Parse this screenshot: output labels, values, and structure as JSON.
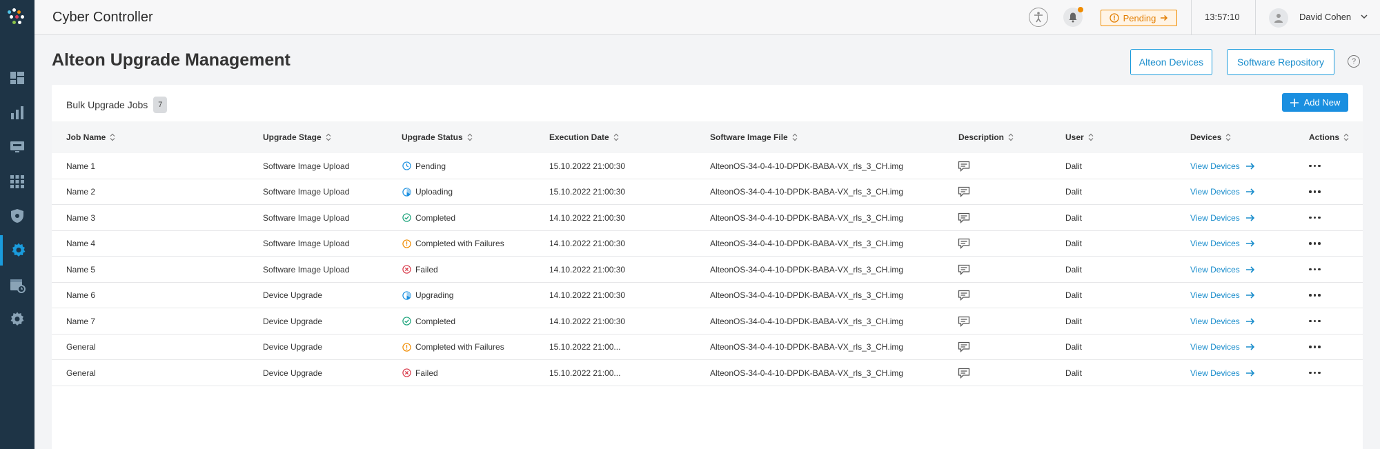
{
  "app": {
    "title": "Cyber Controller"
  },
  "topbar": {
    "pending_label": "Pending",
    "time": "13:57:10",
    "user_name": "David Cohen"
  },
  "sidebar": {
    "items": [
      {
        "icon": "dashboard-icon"
      },
      {
        "icon": "analytics-icon"
      },
      {
        "icon": "monitor-icon"
      },
      {
        "icon": "apps-grid-icon"
      },
      {
        "icon": "shield-icon"
      },
      {
        "icon": "gear-icon",
        "active": true
      },
      {
        "icon": "scheduler-icon"
      },
      {
        "icon": "settings-icon"
      }
    ]
  },
  "page": {
    "title": "Alteon Upgrade Management",
    "alteon_devices_label": "Alteon Devices",
    "software_repository_label": "Software Repository",
    "help_label": "?"
  },
  "card": {
    "title": "Bulk Upgrade Jobs",
    "count": "7",
    "add_label": "Add New"
  },
  "table": {
    "headers": {
      "job_name": "Job Name",
      "upgrade_stage": "Upgrade Stage",
      "upgrade_status": "Upgrade Status",
      "execution_date": "Execution Date",
      "software_image": "Software Image File",
      "description": "Description",
      "user": "User",
      "devices": "Devices",
      "actions": "Actions"
    },
    "rows": [
      {
        "name": "Name 1",
        "stage": "Software Image Upload",
        "status": "Pending",
        "status_type": "pending",
        "date": "15.10.2022 21:00:30",
        "image": "AlteonOS-34-0-4-10-DPDK-BABA-VX_rls_3_CH.img",
        "user": "Dalit",
        "devices": "View Devices"
      },
      {
        "name": "Name 2",
        "stage": "Software Image Upload",
        "status": "Uploading",
        "status_type": "progress",
        "date": "15.10.2022 21:00:30",
        "image": "AlteonOS-34-0-4-10-DPDK-BABA-VX_rls_3_CH.img",
        "user": "Dalit",
        "devices": "View Devices"
      },
      {
        "name": "Name 3",
        "stage": "Software Image Upload",
        "status": "Completed",
        "status_type": "completed",
        "date": "14.10.2022 21:00:30",
        "image": "AlteonOS-34-0-4-10-DPDK-BABA-VX_rls_3_CH.img",
        "user": "Dalit",
        "devices": "View Devices"
      },
      {
        "name": "Name 4",
        "stage": "Software Image Upload",
        "status": "Completed with Failures",
        "status_type": "warning",
        "date": "14.10.2022 21:00:30",
        "image": "AlteonOS-34-0-4-10-DPDK-BABA-VX_rls_3_CH.img",
        "user": "Dalit",
        "devices": "View Devices"
      },
      {
        "name": "Name 5",
        "stage": "Software Image Upload",
        "status": "Failed",
        "status_type": "failed",
        "date": "14.10.2022 21:00:30",
        "image": "AlteonOS-34-0-4-10-DPDK-BABA-VX_rls_3_CH.img",
        "user": "Dalit",
        "devices": "View Devices"
      },
      {
        "name": "Name 6",
        "stage": "Device Upgrade",
        "status": "Upgrading",
        "status_type": "progress",
        "date": "14.10.2022 21:00:30",
        "image": "AlteonOS-34-0-4-10-DPDK-BABA-VX_rls_3_CH.img",
        "user": "Dalit",
        "devices": "View Devices"
      },
      {
        "name": "Name 7",
        "stage": "Device Upgrade",
        "status": "Completed",
        "status_type": "completed",
        "date": "14.10.2022 21:00:30",
        "image": "AlteonOS-34-0-4-10-DPDK-BABA-VX_rls_3_CH.img",
        "user": "Dalit",
        "devices": "View Devices"
      },
      {
        "name": "General",
        "stage": "Device Upgrade",
        "status": "Completed with Failures",
        "status_type": "warning",
        "date": "15.10.2022 21:00...",
        "image": "AlteonOS-34-0-4-10-DPDK-BABA-VX_rls_3_CH.img",
        "user": "Dalit",
        "devices": "View Devices"
      },
      {
        "name": "General",
        "stage": "Device Upgrade",
        "status": "Failed",
        "status_type": "failed",
        "date": "15.10.2022 21:00...",
        "image": "AlteonOS-34-0-4-10-DPDK-BABA-VX_rls_3_CH.img",
        "user": "Dalit",
        "devices": "View Devices"
      }
    ]
  },
  "colors": {
    "sidebar": "#1e3446",
    "accent": "#1a8fe0",
    "pending": "#f08c00",
    "success": "#1aa37a",
    "error": "#d93a4a"
  }
}
